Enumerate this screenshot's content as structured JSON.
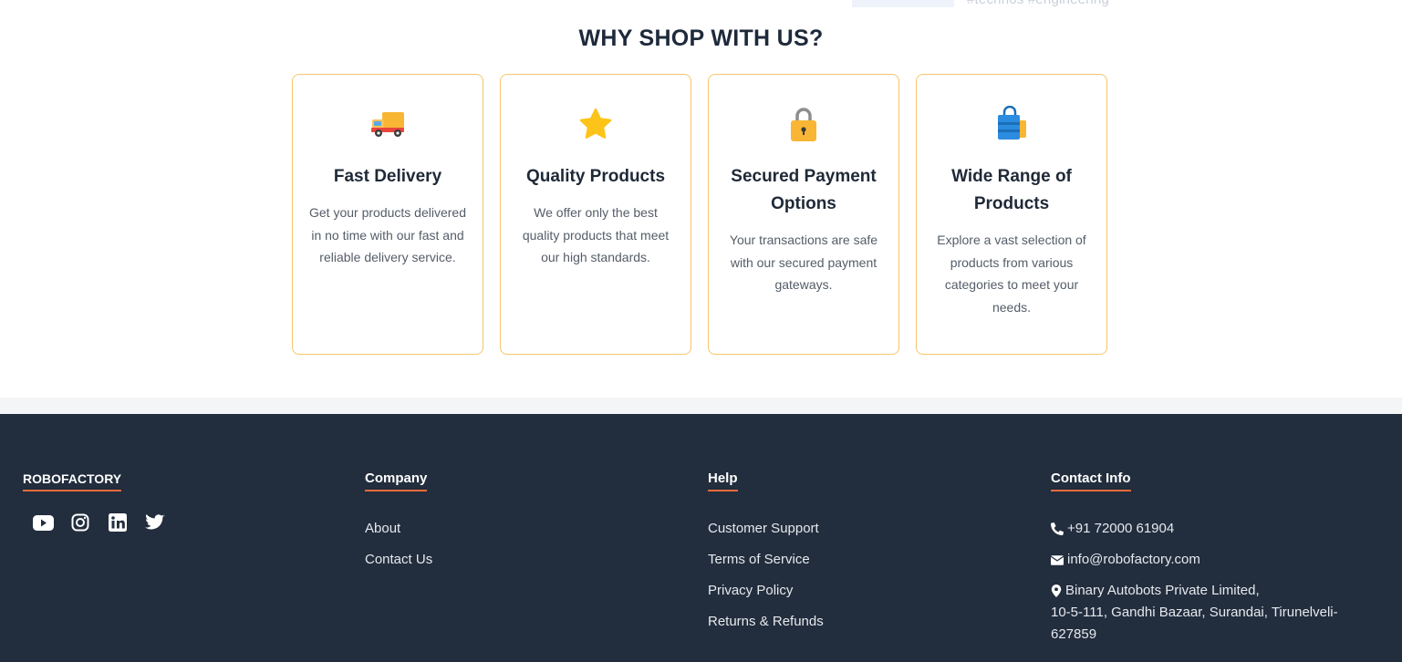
{
  "top_fragment": "#technos #engineering",
  "section": {
    "title": "WHY SHOP WITH US?",
    "cards": [
      {
        "icon": "delivery-truck-icon",
        "title": "Fast Delivery",
        "text": "Get your products delivered in no time with our fast and reliable delivery service."
      },
      {
        "icon": "star-icon",
        "title": "Quality Products",
        "text": "We offer only the best quality products that meet our high standards."
      },
      {
        "icon": "lock-icon",
        "title": "Secured Payment Options",
        "text": "Your transactions are safe with our secured payment gateways."
      },
      {
        "icon": "shopping-bags-icon",
        "title": "Wide Range of Products",
        "text": "Explore a vast selection of products from various categories to meet your needs."
      }
    ]
  },
  "footer": {
    "brand": "ROBOFACTORY",
    "social": [
      "youtube-icon",
      "instagram-icon",
      "linkedin-icon",
      "twitter-icon"
    ],
    "company": {
      "heading": "Company",
      "links": [
        "About",
        "Contact Us"
      ]
    },
    "help": {
      "heading": "Help",
      "links": [
        "Customer Support",
        "Terms of Service",
        "Privacy Policy",
        "Returns & Refunds"
      ]
    },
    "contact": {
      "heading": "Contact Info",
      "phone": "+91 72000 61904",
      "email": "info@robofactory.com",
      "address_line1": "Binary Autobots Private Limited,",
      "address_line2": "10-5-111, Gandhi Bazaar, Surandai, Tirunelveli-627859"
    }
  },
  "colors": {
    "card_border": "#f6c56b",
    "footer_bg": "#222d3d",
    "accent_underline": "#e86a3a"
  }
}
